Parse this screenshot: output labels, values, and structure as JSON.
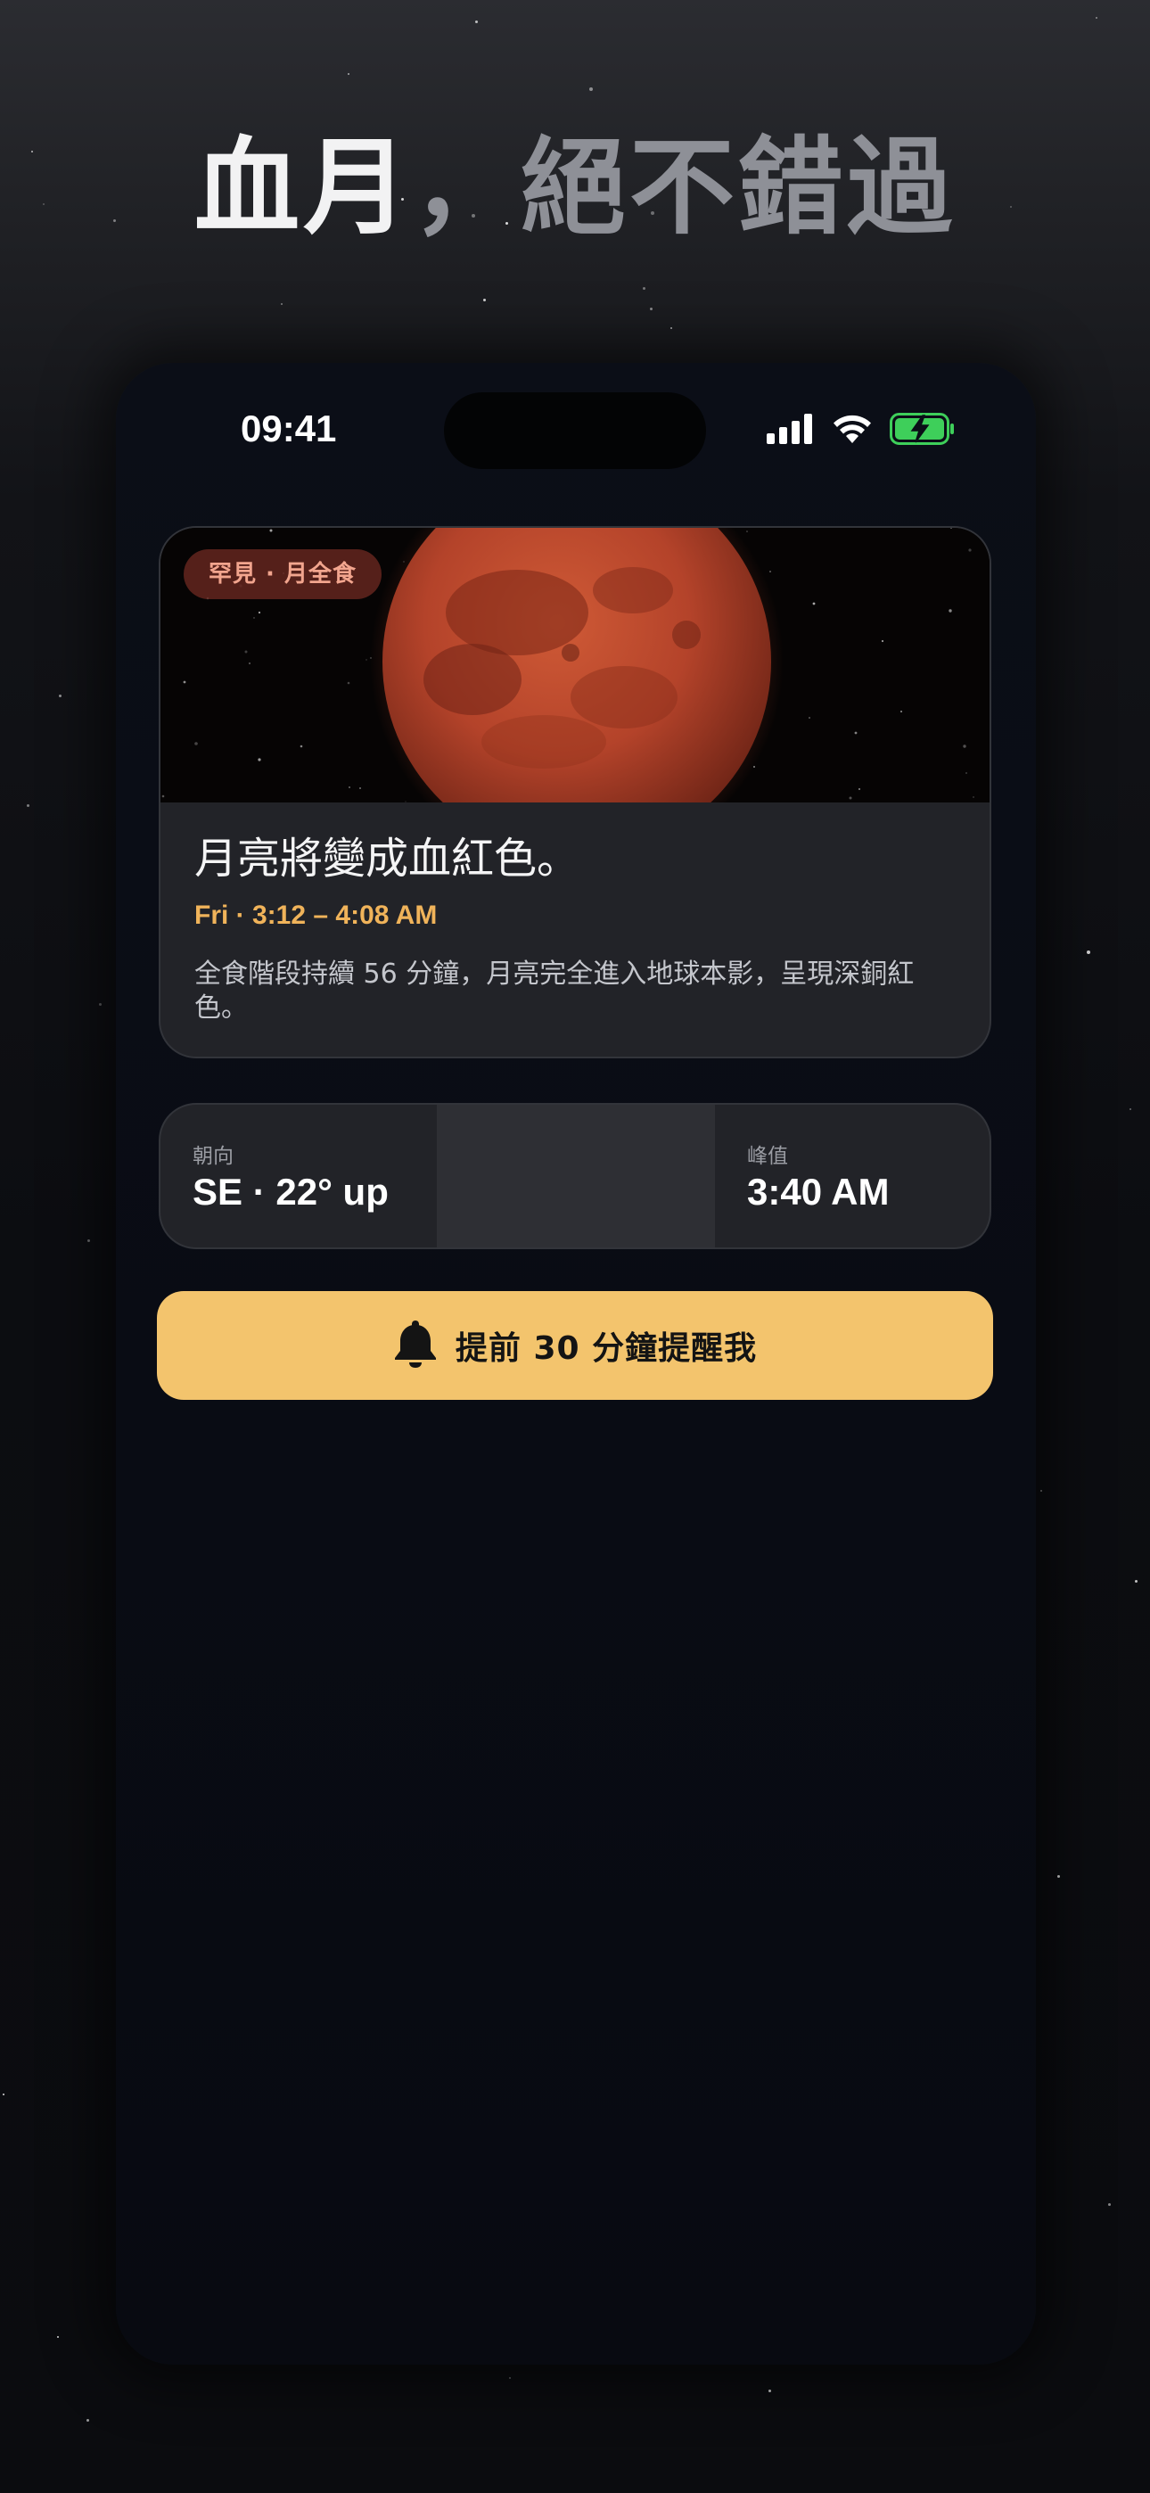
{
  "headline": {
    "accent": "血月",
    "rest": "，絕不錯過"
  },
  "status_bar": {
    "time": "09:41",
    "icons": [
      "cellular-signal-icon",
      "wifi-icon",
      "battery-charging-icon"
    ]
  },
  "event_card": {
    "badge": "罕見 · 月全食",
    "title": "月亮將變成血紅色。",
    "time": "Fri · 3:12 – 4:08 AM",
    "description": "全食階段持續 56 分鐘，月亮完全進入地球本影，呈現深銅紅色。"
  },
  "info_bar": {
    "direction_label": "朝向",
    "direction_value": "SE · 22° up",
    "peak_label": "峰值",
    "peak_value": "3:40 AM"
  },
  "remind_button": {
    "icon": "bell-icon",
    "label": "提前 30 分鐘提醒我"
  },
  "colors": {
    "accent": "#f3c46d",
    "event_time": "#f0b35a",
    "badge_text": "#f2a58e",
    "moon": "#b8432a",
    "battery": "#3ecf5a"
  }
}
